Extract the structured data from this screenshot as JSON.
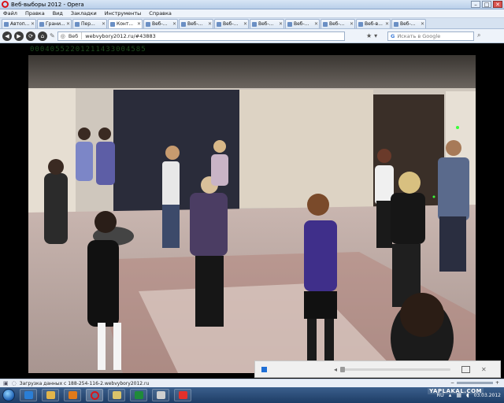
{
  "window": {
    "title": "Веб-выборы 2012 - Opera"
  },
  "menu": [
    "Файл",
    "Правка",
    "Вид",
    "Закладки",
    "Инструменты",
    "Справка"
  ],
  "tabs": [
    {
      "label": "Автоп...",
      "active": false
    },
    {
      "label": "Грани...",
      "active": false
    },
    {
      "label": "Пер...",
      "active": false
    },
    {
      "label": "Конт...",
      "active": true
    },
    {
      "label": "Веб-...",
      "active": false
    },
    {
      "label": "Веб-...",
      "active": false
    },
    {
      "label": "Веб-...",
      "active": false
    },
    {
      "label": "Веб-...",
      "active": false
    },
    {
      "label": "Веб-...",
      "active": false
    },
    {
      "label": "Веб-...",
      "active": false
    },
    {
      "label": "Веб-в...",
      "active": false
    },
    {
      "label": "Веб-...",
      "active": false
    }
  ],
  "address": {
    "page_label": "Веб",
    "url": "webvybory2012.ru/#43883",
    "search_placeholder": "Искать в Google"
  },
  "video": {
    "watermark": "00040552201211433004585"
  },
  "status": {
    "text": "Загрузка данных с 188-254-116-2.webvybory2012.ru"
  },
  "taskbar": {
    "language": "RU",
    "time": "",
    "date": "03.03.2012",
    "overlay": "YAPLAKAL.COM"
  },
  "colors": {
    "titlebar": "#c8daf0",
    "accent": "#1f6fd6",
    "opera_red": "#d8141a",
    "taskbar": "#2a4b78"
  }
}
